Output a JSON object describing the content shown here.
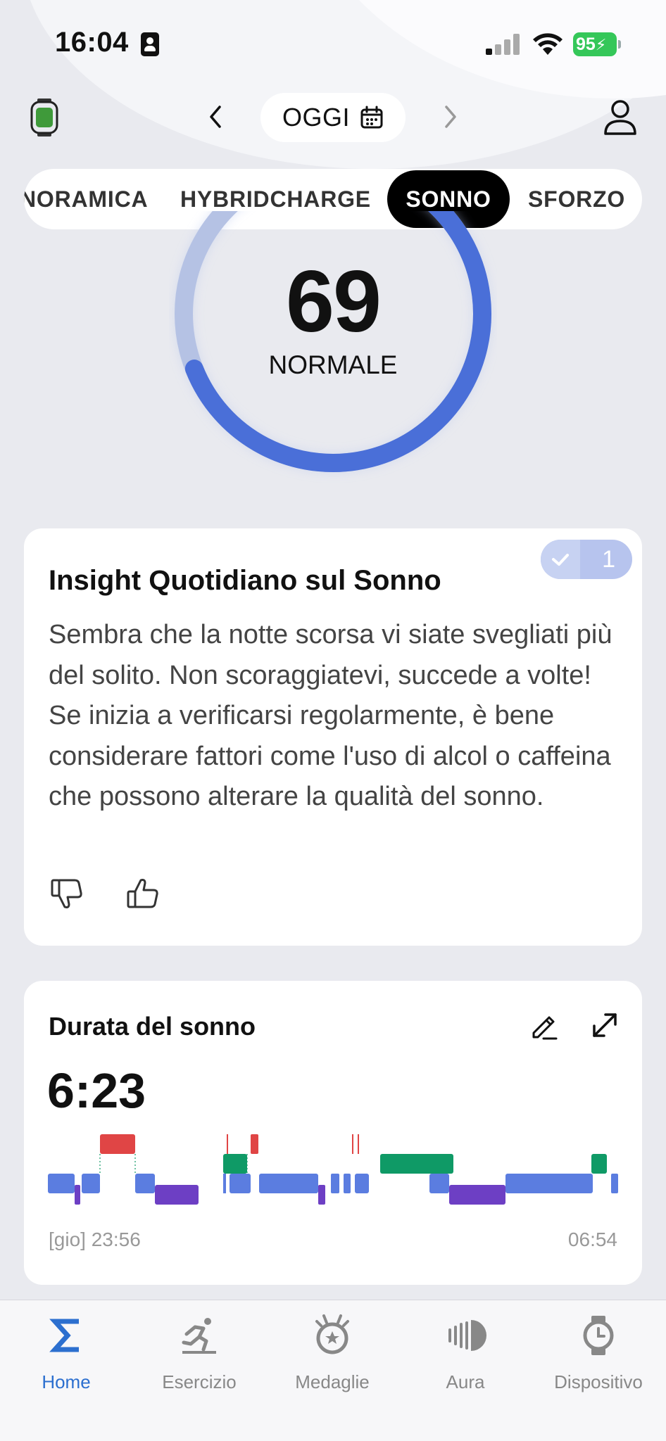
{
  "status_bar": {
    "time": "16:04",
    "battery": "95"
  },
  "header": {
    "date_label": "OGGI"
  },
  "tabs": [
    {
      "label": "NORAMICA"
    },
    {
      "label": "HYBRIDCHARGE"
    },
    {
      "label": "SONNO",
      "active": true
    },
    {
      "label": "SFORZO"
    }
  ],
  "score": {
    "value": "69",
    "label": "NORMALE",
    "fraction": 0.69,
    "accent_color": "#4a6fd8"
  },
  "insight": {
    "title": "Insight Quotidiano sul Sonno",
    "body": "Sembra che la notte scorsa vi siate svegliati più del solito. Non scoraggiatevi, succede a volte! Se inizia a verificarsi regolarmente, è bene considerare fattori come l'uso di alcol o caffeina che possono alterare la qualità del sonno.",
    "badge_count": "1"
  },
  "sleep_duration": {
    "title": "Durata del sonno",
    "value": "6:23",
    "start_label": "[gio] 23:56",
    "end_label": "06:54",
    "stage_colors": {
      "awake": "#e04545",
      "rem": "#0f9a66",
      "light": "#5b7de0",
      "deep": "#6d3fc4"
    }
  },
  "bottom_nav": [
    {
      "label": "Home",
      "icon": "sigma-icon",
      "active": true
    },
    {
      "label": "Esercizio",
      "icon": "runner-icon"
    },
    {
      "label": "Medaglie",
      "icon": "medal-icon"
    },
    {
      "label": "Aura",
      "icon": "aura-icon"
    },
    {
      "label": "Dispositivo",
      "icon": "watch-icon"
    }
  ]
}
